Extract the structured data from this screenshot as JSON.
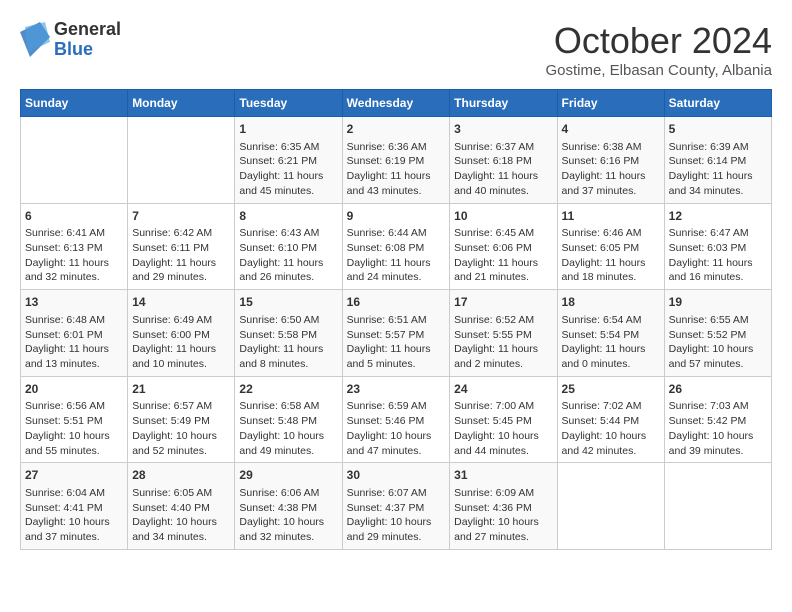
{
  "header": {
    "logo_general": "General",
    "logo_blue": "Blue",
    "month_title": "October 2024",
    "subtitle": "Gostime, Elbasan County, Albania"
  },
  "days_of_week": [
    "Sunday",
    "Monday",
    "Tuesday",
    "Wednesday",
    "Thursday",
    "Friday",
    "Saturday"
  ],
  "weeks": [
    [
      {
        "day": "",
        "sunrise": "",
        "sunset": "",
        "daylight": ""
      },
      {
        "day": "",
        "sunrise": "",
        "sunset": "",
        "daylight": ""
      },
      {
        "day": "1",
        "sunrise": "Sunrise: 6:35 AM",
        "sunset": "Sunset: 6:21 PM",
        "daylight": "Daylight: 11 hours and 45 minutes."
      },
      {
        "day": "2",
        "sunrise": "Sunrise: 6:36 AM",
        "sunset": "Sunset: 6:19 PM",
        "daylight": "Daylight: 11 hours and 43 minutes."
      },
      {
        "day": "3",
        "sunrise": "Sunrise: 6:37 AM",
        "sunset": "Sunset: 6:18 PM",
        "daylight": "Daylight: 11 hours and 40 minutes."
      },
      {
        "day": "4",
        "sunrise": "Sunrise: 6:38 AM",
        "sunset": "Sunset: 6:16 PM",
        "daylight": "Daylight: 11 hours and 37 minutes."
      },
      {
        "day": "5",
        "sunrise": "Sunrise: 6:39 AM",
        "sunset": "Sunset: 6:14 PM",
        "daylight": "Daylight: 11 hours and 34 minutes."
      }
    ],
    [
      {
        "day": "6",
        "sunrise": "Sunrise: 6:41 AM",
        "sunset": "Sunset: 6:13 PM",
        "daylight": "Daylight: 11 hours and 32 minutes."
      },
      {
        "day": "7",
        "sunrise": "Sunrise: 6:42 AM",
        "sunset": "Sunset: 6:11 PM",
        "daylight": "Daylight: 11 hours and 29 minutes."
      },
      {
        "day": "8",
        "sunrise": "Sunrise: 6:43 AM",
        "sunset": "Sunset: 6:10 PM",
        "daylight": "Daylight: 11 hours and 26 minutes."
      },
      {
        "day": "9",
        "sunrise": "Sunrise: 6:44 AM",
        "sunset": "Sunset: 6:08 PM",
        "daylight": "Daylight: 11 hours and 24 minutes."
      },
      {
        "day": "10",
        "sunrise": "Sunrise: 6:45 AM",
        "sunset": "Sunset: 6:06 PM",
        "daylight": "Daylight: 11 hours and 21 minutes."
      },
      {
        "day": "11",
        "sunrise": "Sunrise: 6:46 AM",
        "sunset": "Sunset: 6:05 PM",
        "daylight": "Daylight: 11 hours and 18 minutes."
      },
      {
        "day": "12",
        "sunrise": "Sunrise: 6:47 AM",
        "sunset": "Sunset: 6:03 PM",
        "daylight": "Daylight: 11 hours and 16 minutes."
      }
    ],
    [
      {
        "day": "13",
        "sunrise": "Sunrise: 6:48 AM",
        "sunset": "Sunset: 6:01 PM",
        "daylight": "Daylight: 11 hours and 13 minutes."
      },
      {
        "day": "14",
        "sunrise": "Sunrise: 6:49 AM",
        "sunset": "Sunset: 6:00 PM",
        "daylight": "Daylight: 11 hours and 10 minutes."
      },
      {
        "day": "15",
        "sunrise": "Sunrise: 6:50 AM",
        "sunset": "Sunset: 5:58 PM",
        "daylight": "Daylight: 11 hours and 8 minutes."
      },
      {
        "day": "16",
        "sunrise": "Sunrise: 6:51 AM",
        "sunset": "Sunset: 5:57 PM",
        "daylight": "Daylight: 11 hours and 5 minutes."
      },
      {
        "day": "17",
        "sunrise": "Sunrise: 6:52 AM",
        "sunset": "Sunset: 5:55 PM",
        "daylight": "Daylight: 11 hours and 2 minutes."
      },
      {
        "day": "18",
        "sunrise": "Sunrise: 6:54 AM",
        "sunset": "Sunset: 5:54 PM",
        "daylight": "Daylight: 11 hours and 0 minutes."
      },
      {
        "day": "19",
        "sunrise": "Sunrise: 6:55 AM",
        "sunset": "Sunset: 5:52 PM",
        "daylight": "Daylight: 10 hours and 57 minutes."
      }
    ],
    [
      {
        "day": "20",
        "sunrise": "Sunrise: 6:56 AM",
        "sunset": "Sunset: 5:51 PM",
        "daylight": "Daylight: 10 hours and 55 minutes."
      },
      {
        "day": "21",
        "sunrise": "Sunrise: 6:57 AM",
        "sunset": "Sunset: 5:49 PM",
        "daylight": "Daylight: 10 hours and 52 minutes."
      },
      {
        "day": "22",
        "sunrise": "Sunrise: 6:58 AM",
        "sunset": "Sunset: 5:48 PM",
        "daylight": "Daylight: 10 hours and 49 minutes."
      },
      {
        "day": "23",
        "sunrise": "Sunrise: 6:59 AM",
        "sunset": "Sunset: 5:46 PM",
        "daylight": "Daylight: 10 hours and 47 minutes."
      },
      {
        "day": "24",
        "sunrise": "Sunrise: 7:00 AM",
        "sunset": "Sunset: 5:45 PM",
        "daylight": "Daylight: 10 hours and 44 minutes."
      },
      {
        "day": "25",
        "sunrise": "Sunrise: 7:02 AM",
        "sunset": "Sunset: 5:44 PM",
        "daylight": "Daylight: 10 hours and 42 minutes."
      },
      {
        "day": "26",
        "sunrise": "Sunrise: 7:03 AM",
        "sunset": "Sunset: 5:42 PM",
        "daylight": "Daylight: 10 hours and 39 minutes."
      }
    ],
    [
      {
        "day": "27",
        "sunrise": "Sunrise: 6:04 AM",
        "sunset": "Sunset: 4:41 PM",
        "daylight": "Daylight: 10 hours and 37 minutes."
      },
      {
        "day": "28",
        "sunrise": "Sunrise: 6:05 AM",
        "sunset": "Sunset: 4:40 PM",
        "daylight": "Daylight: 10 hours and 34 minutes."
      },
      {
        "day": "29",
        "sunrise": "Sunrise: 6:06 AM",
        "sunset": "Sunset: 4:38 PM",
        "daylight": "Daylight: 10 hours and 32 minutes."
      },
      {
        "day": "30",
        "sunrise": "Sunrise: 6:07 AM",
        "sunset": "Sunset: 4:37 PM",
        "daylight": "Daylight: 10 hours and 29 minutes."
      },
      {
        "day": "31",
        "sunrise": "Sunrise: 6:09 AM",
        "sunset": "Sunset: 4:36 PM",
        "daylight": "Daylight: 10 hours and 27 minutes."
      },
      {
        "day": "",
        "sunrise": "",
        "sunset": "",
        "daylight": ""
      },
      {
        "day": "",
        "sunrise": "",
        "sunset": "",
        "daylight": ""
      }
    ]
  ]
}
